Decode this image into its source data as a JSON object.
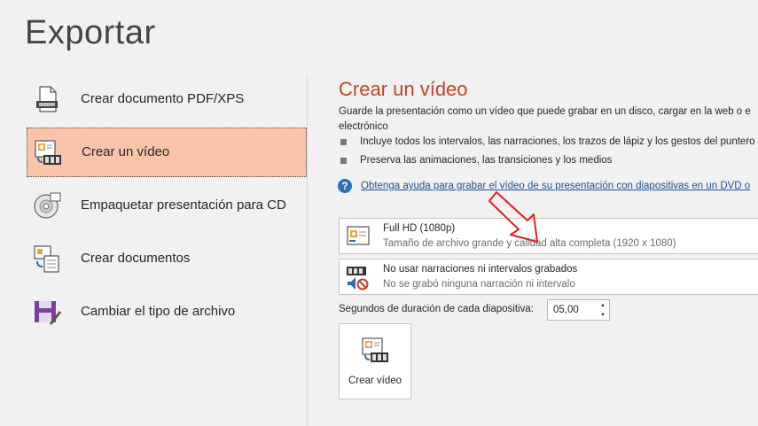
{
  "page": {
    "title": "Exportar"
  },
  "nav": {
    "items": [
      {
        "label": "Crear documento PDF/XPS",
        "icon": "pdf-document-icon"
      },
      {
        "label": "Crear un vídeo",
        "icon": "video-icon",
        "selected": true
      },
      {
        "label": "Empaquetar presentación para CD",
        "icon": "cd-package-icon"
      },
      {
        "label": "Crear documentos",
        "icon": "handouts-icon"
      },
      {
        "label": "Cambiar el tipo de archivo",
        "icon": "save-as-icon"
      }
    ]
  },
  "main": {
    "title": "Crear un vídeo",
    "description": "Guarde la presentación como un vídeo que puede grabar en un disco, cargar en la web o e electrónico",
    "bullets": [
      "Incluye todos los intervalos, las narraciones, los trazos de lápiz y los gestos del puntero",
      "Preserva las animaciones, las transiciones y los medios"
    ],
    "help_link": "Obtenga ayuda para grabar el vídeo de su presentación con diapositivas en un DVD o",
    "quality_dropdown": {
      "title": "Full HD (1080p)",
      "subtitle": "Tamaño de archivo grande y calidad alta completa (1920 x 1080)",
      "icon": "presentation-quality-icon"
    },
    "narration_dropdown": {
      "title": "No usar narraciones ni intervalos grabados",
      "subtitle": "No se grabó ninguna narración ni intervalo",
      "icon": "no-narration-icon"
    },
    "duration": {
      "label": "Segundos de duración de cada diapositiva:",
      "value": "05,00"
    },
    "create_button": {
      "label": "Crear vídeo",
      "icon": "create-video-icon"
    }
  },
  "colors": {
    "accent": "#c0442a",
    "selected_bg": "#f9c4a9",
    "link": "#1f4e93",
    "annotation_arrow": "#e02020"
  }
}
